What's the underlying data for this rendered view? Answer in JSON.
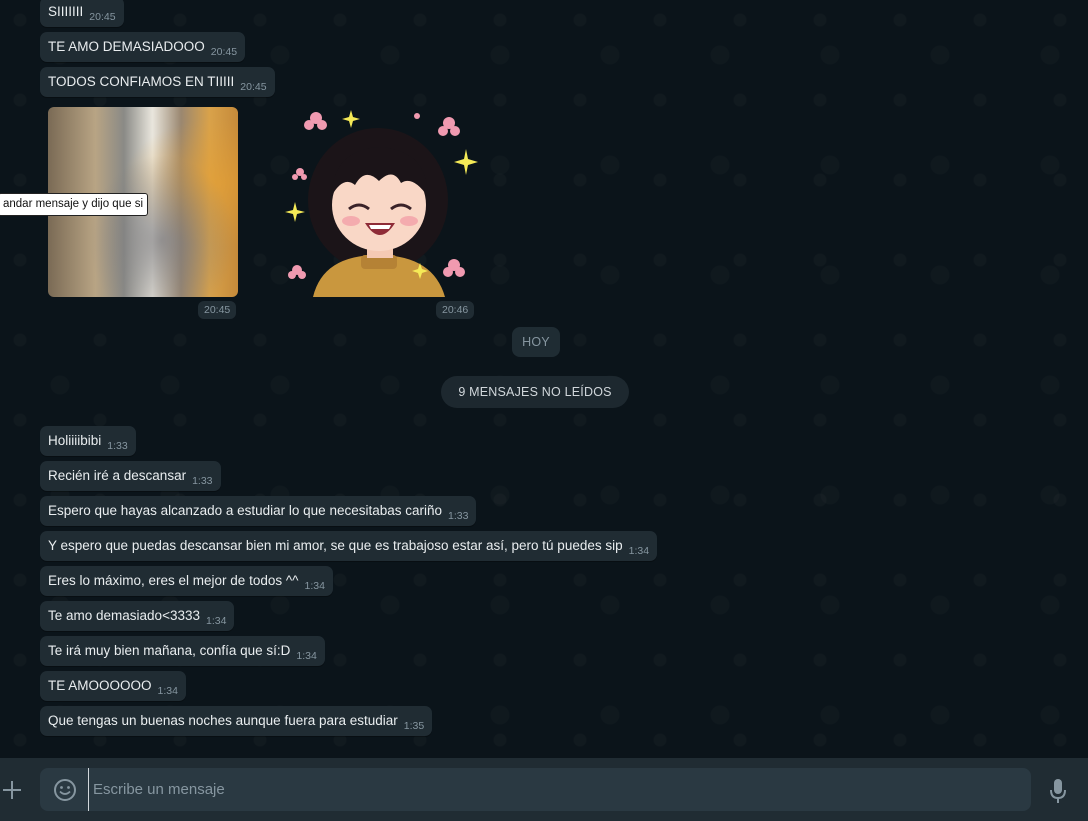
{
  "chat": {
    "messages_top": [
      {
        "text": "SIIIIIII",
        "time": "20:45"
      },
      {
        "text": "TE AMO DEMASIADOOO",
        "time": "20:45"
      },
      {
        "text": "TODOS CONFIAMOS EN TIIIII",
        "time": "20:45"
      }
    ],
    "media": {
      "video_time": "20:45",
      "sticker_time": "20:46",
      "tooltip": "andar mensaje y dijo que si"
    },
    "date_divider": "HOY",
    "unread_banner": "9 MENSAJES NO LEÍDOS",
    "messages_bottom": [
      {
        "text": "Holiiiibibi",
        "time": "1:33"
      },
      {
        "text": "Recién iré a descansar",
        "time": "1:33"
      },
      {
        "text": "Espero que hayas alcanzado a estudiar lo que necesitabas cariño",
        "time": "1:33"
      },
      {
        "text": "Y espero que puedas descansar bien mi amor, se que es trabajoso estar así, pero tú puedes sip",
        "time": "1:34"
      },
      {
        "text": "Eres lo máximo, eres el mejor de todos ^^",
        "time": "1:34"
      },
      {
        "text": "Te amo demasiado<3333",
        "time": "1:34"
      },
      {
        "text": "Te irá muy bien mañana, confía que sí:D",
        "time": "1:34"
      },
      {
        "text": "TE AMOOOOOO",
        "time": "1:34"
      },
      {
        "text": "Que tengas un buenas noches aunque fuera para estudiar",
        "time": "1:35"
      }
    ]
  },
  "composer": {
    "placeholder": "Escribe un mensaje",
    "value": ""
  },
  "icons": {
    "attach": "plus-icon",
    "emoji": "emoji-icon",
    "mic": "microphone-icon"
  },
  "colors": {
    "background": "#0b141a",
    "bubble": "#202c33",
    "composer": "#2a3942",
    "time": "#8696a0"
  }
}
